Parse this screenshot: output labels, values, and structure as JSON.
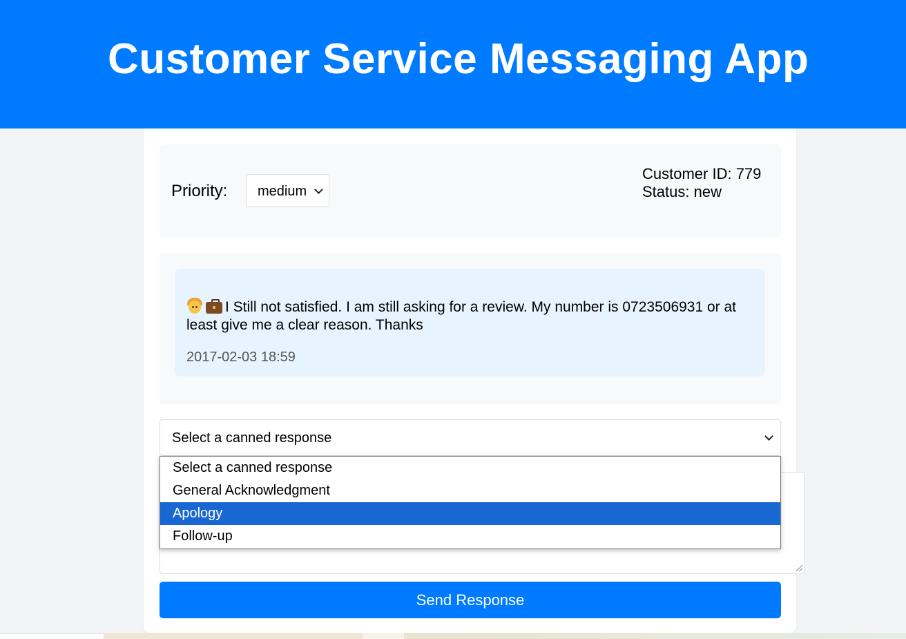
{
  "header": {
    "title": "Customer Service Messaging App"
  },
  "info": {
    "priority_label": "Priority:",
    "priority_value": "medium",
    "customer_id": "Customer ID: 779",
    "status": "Status: new"
  },
  "messages": [
    {
      "icons": [
        "person-icon",
        "briefcase-icon"
      ],
      "text": "I Still not satisfied. I am still asking for a review. My number is 0723506931 or at least give me a clear reason. Thanks",
      "timestamp": "2017-02-03 18:59"
    }
  ],
  "response": {
    "select_value": "Select a canned response",
    "options": [
      "Select a canned response",
      "General Acknowledgment",
      "Apology",
      "Follow-up"
    ],
    "highlighted_option": "Apology",
    "send_label": "Send Response"
  },
  "colors": {
    "accent": "#007bff",
    "highlight": "#1967d2",
    "message_bg": "#e7f3fe"
  }
}
